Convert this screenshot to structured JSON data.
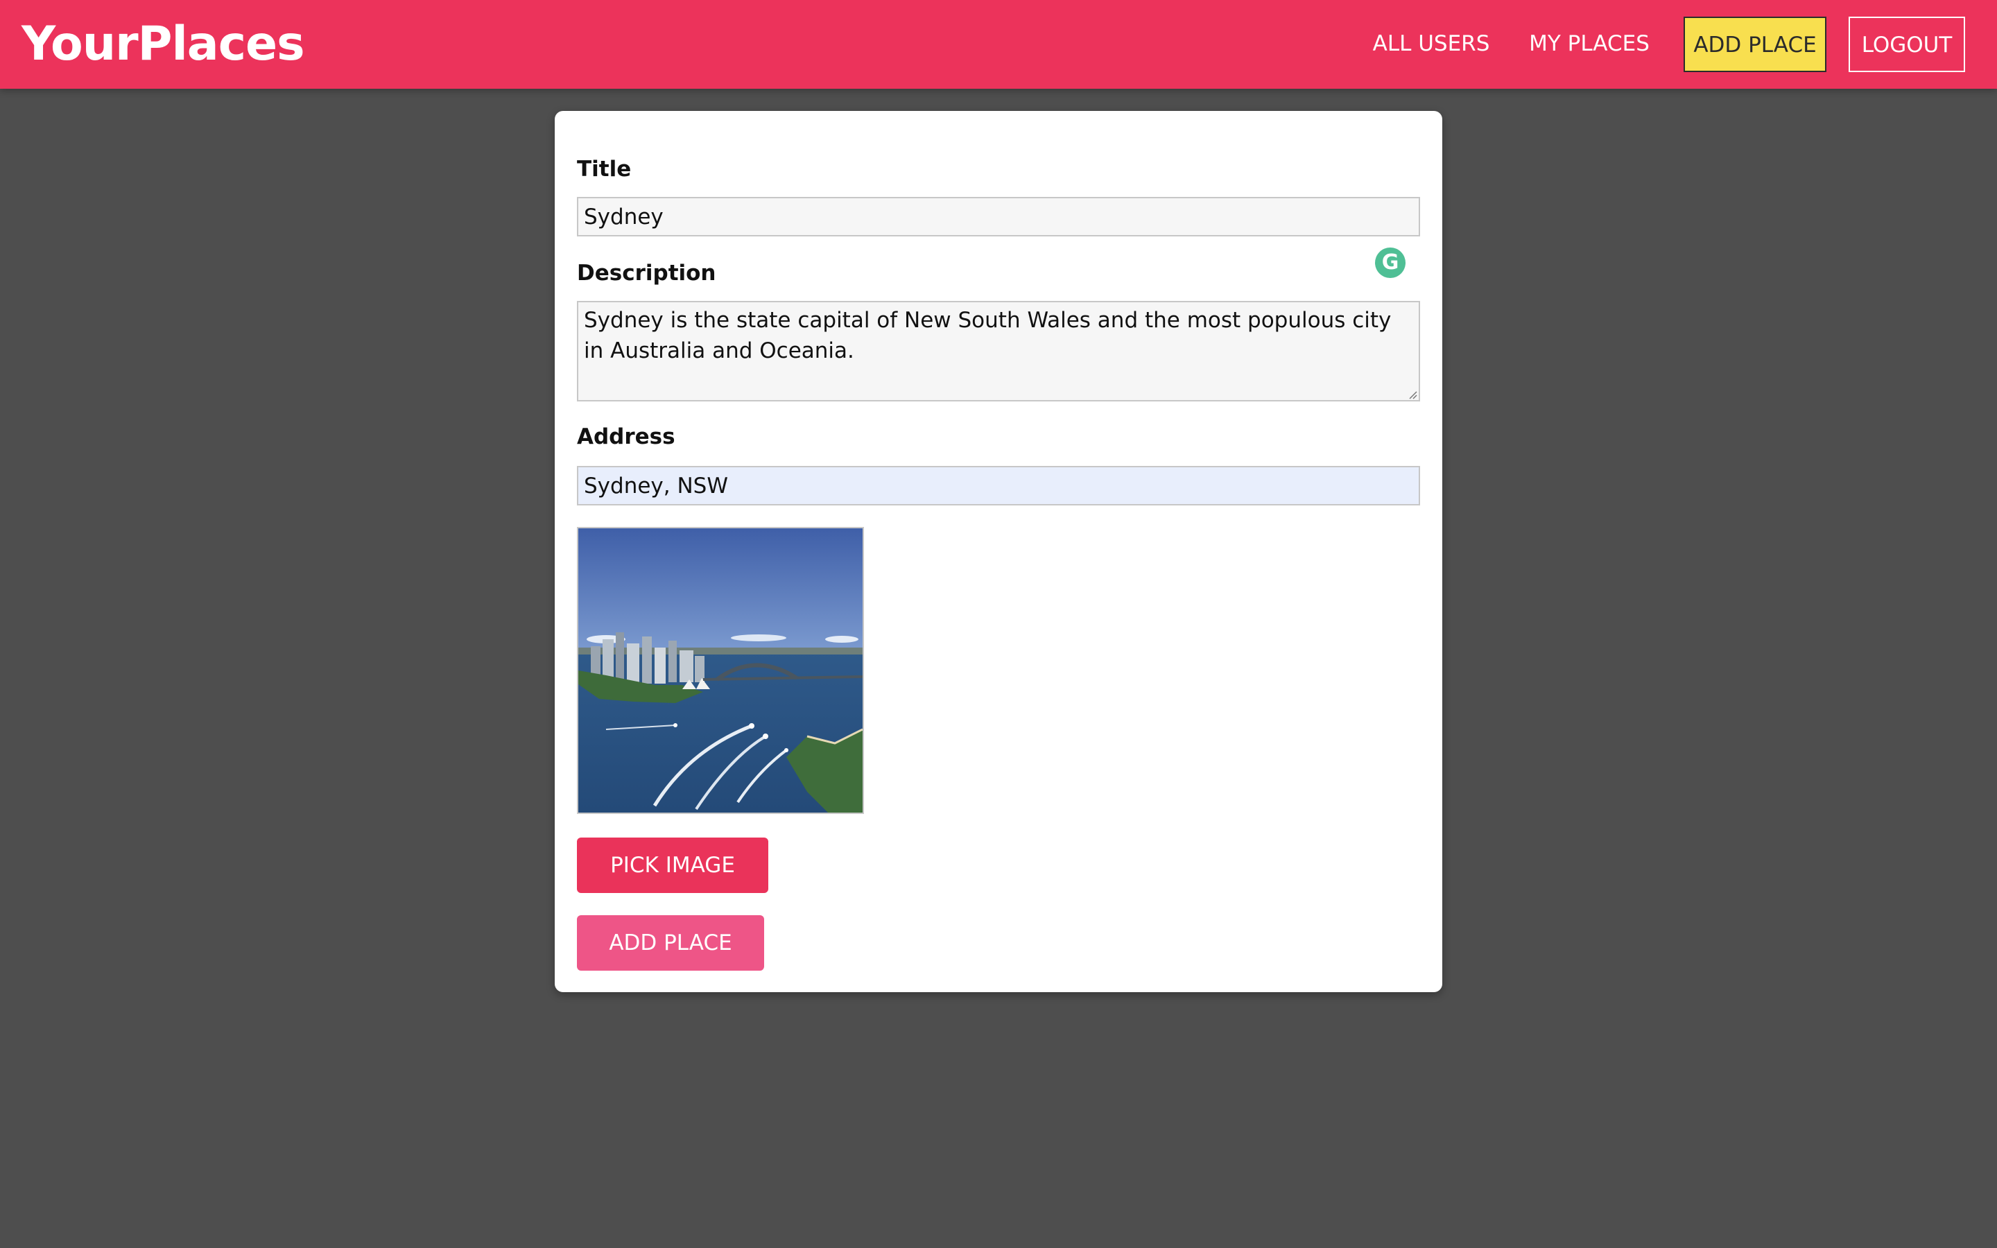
{
  "header": {
    "logo": "YourPlaces",
    "nav": {
      "all_users": "ALL USERS",
      "my_places": "MY PLACES",
      "add_place": "ADD PLACE",
      "logout": "LOGOUT"
    }
  },
  "form": {
    "title": {
      "label": "Title",
      "value": "Sydney"
    },
    "description": {
      "label": "Description",
      "value": "Sydney is the state capital of New South Wales and the most populous city in Australia and Oceania."
    },
    "address": {
      "label": "Address",
      "value": "Sydney, NSW"
    },
    "image_preview": {
      "icon": "harbour-photo"
    },
    "grammar_icon": {
      "glyph": "G"
    },
    "pick_image_label": "PICK IMAGE",
    "submit_label": "ADD PLACE"
  },
  "colors": {
    "header": "#ec335b",
    "active_nav": "#f8df4f",
    "background": "#4e4e4e",
    "primary_button": "#ea335a",
    "submit_button": "#ee5587",
    "grammar_icon": "#4fbf95"
  }
}
